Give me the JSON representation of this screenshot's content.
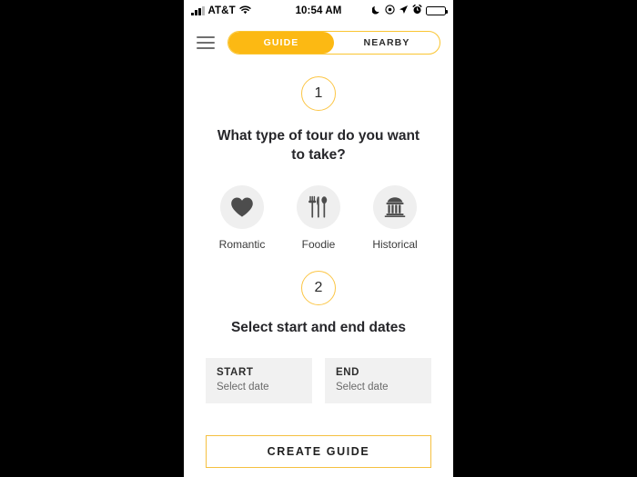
{
  "status_bar": {
    "carrier": "AT&T",
    "time": "10:54 AM",
    "signal_icon": "signal-bars-icon",
    "wifi_icon": "wifi-icon",
    "dnd_icon": "moon-icon",
    "rotation_lock_icon": "rotation-lock-icon",
    "location_icon": "location-arrow-icon",
    "alarm_icon": "alarm-clock-icon",
    "battery_icon": "battery-icon"
  },
  "top_nav": {
    "menu_icon": "hamburger-menu-icon",
    "tabs": [
      {
        "label": "GUIDE",
        "active": true
      },
      {
        "label": "NEARBY",
        "active": false
      }
    ]
  },
  "steps": {
    "step_one_number": "1",
    "step_one_question": "What type of tour do you want to take?",
    "step_two_number": "2",
    "step_two_heading": "Select start and end dates"
  },
  "tour_types": [
    {
      "label": "Romantic",
      "icon": "heart-icon"
    },
    {
      "label": "Foodie",
      "icon": "cutlery-icon"
    },
    {
      "label": "Historical",
      "icon": "classical-building-icon"
    }
  ],
  "date_fields": [
    {
      "label": "START",
      "value": "Select date"
    },
    {
      "label": "END",
      "value": "Select date"
    }
  ],
  "cta": {
    "label": "CREATE GUIDE"
  },
  "colors": {
    "accent": "#fcb913",
    "accent_border": "#f5c040",
    "icon_circle_bg": "#efefef",
    "field_bg": "#f1f1f1",
    "text_dark": "#26262a",
    "text_muted": "#6a6a6a",
    "screen_bg": "#ffffff",
    "frame_bg": "#000000"
  }
}
